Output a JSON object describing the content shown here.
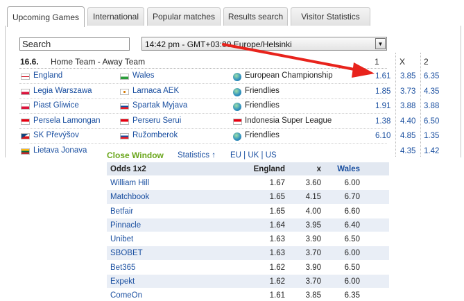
{
  "tabs": [
    {
      "label": "Upcoming Games",
      "active": true
    },
    {
      "label": "International",
      "active": false
    },
    {
      "label": "Popular matches",
      "active": false
    },
    {
      "label": "Results search",
      "active": false
    },
    {
      "label": "Visitor Statistics",
      "active": false
    }
  ],
  "search": {
    "value": "Search"
  },
  "timezone": {
    "value": "14:42 pm - GMT+03:00 Europe/Helsinki"
  },
  "table": {
    "date": "16.6.",
    "teams_header": "Home Team - Away Team",
    "col1": "1",
    "colx": "X",
    "col2": "2",
    "rows": [
      {
        "home": "England",
        "away": "Wales",
        "league": "European Championship",
        "o1": "1.61",
        "ox": "3.85",
        "o2": "6.35",
        "home_flag": "england",
        "away_flag": "wales",
        "league_icon": "globe"
      },
      {
        "home": "Legia Warszawa",
        "away": "Larnaca AEK",
        "league": "Friendlies",
        "o1": "1.85",
        "ox": "3.73",
        "o2": "4.35",
        "home_flag": "poland",
        "away_flag": "cyprus",
        "league_icon": "globe"
      },
      {
        "home": "Piast Gliwice",
        "away": "Spartak Myjava",
        "league": "Friendlies",
        "o1": "1.91",
        "ox": "3.88",
        "o2": "3.88",
        "home_flag": "poland",
        "away_flag": "slovakia",
        "league_icon": "globe"
      },
      {
        "home": "Persela Lamongan",
        "away": "Perseru Serui",
        "league": "Indonesia Super League",
        "o1": "1.38",
        "ox": "4.40",
        "o2": "6.50",
        "home_flag": "indonesia",
        "away_flag": "indonesia",
        "league_icon": "indonesia"
      },
      {
        "home": "SK Převýšov",
        "away": "Ružomberok",
        "league": "Friendlies",
        "o1": "6.10",
        "ox": "4.85",
        "o2": "1.35",
        "home_flag": "czech",
        "away_flag": "slovakia",
        "league_icon": "globe"
      },
      {
        "home": "Lietava Jonava",
        "away": "",
        "league": "",
        "o1": "",
        "ox": "4.35",
        "o2": "1.42",
        "home_flag": "lithuania",
        "away_flag": "",
        "league_icon": ""
      }
    ]
  },
  "popup": {
    "close_label": "Close Window",
    "stats_label": "Statistics ↑",
    "region_links": "EU | UK | US",
    "header": {
      "bookmaker": "Odds 1x2",
      "home": "England",
      "draw": "x",
      "away": "Wales"
    },
    "rows": [
      {
        "bookmaker": "William Hill",
        "home": "1.67",
        "draw": "3.60",
        "away": "6.00"
      },
      {
        "bookmaker": "Matchbook",
        "home": "1.65",
        "draw": "4.15",
        "away": "6.70"
      },
      {
        "bookmaker": "Betfair",
        "home": "1.65",
        "draw": "4.00",
        "away": "6.60"
      },
      {
        "bookmaker": "Pinnacle",
        "home": "1.64",
        "draw": "3.95",
        "away": "6.40"
      },
      {
        "bookmaker": "Unibet",
        "home": "1.63",
        "draw": "3.90",
        "away": "6.50"
      },
      {
        "bookmaker": "SBOBET",
        "home": "1.63",
        "draw": "3.70",
        "away": "6.00"
      },
      {
        "bookmaker": "Bet365",
        "home": "1.62",
        "draw": "3.90",
        "away": "6.50"
      },
      {
        "bookmaker": "Expekt",
        "home": "1.62",
        "draw": "3.70",
        "away": "6.00"
      },
      {
        "bookmaker": "ComeOn",
        "home": "1.61",
        "draw": "3.85",
        "away": "6.35"
      }
    ]
  },
  "colors": {
    "link": "#1a4fa0",
    "close": "#6aa61b",
    "arrow": "#e8231c",
    "popup_shade": "#e9eef6"
  }
}
